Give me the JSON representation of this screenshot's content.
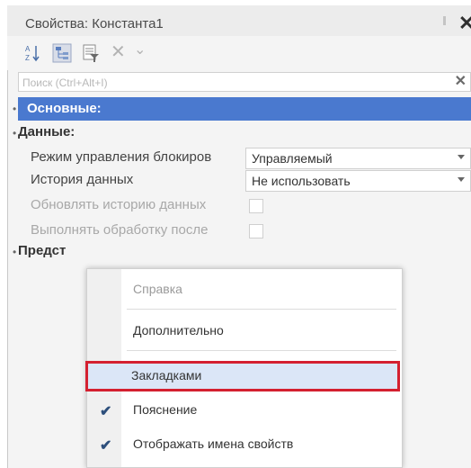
{
  "window": {
    "title": "Свойства: Константа1"
  },
  "search": {
    "placeholder": "Поиск (Ctrl+Alt+I)"
  },
  "groups": {
    "main": "Основные:",
    "data": "Данные:",
    "presentation": "Предст"
  },
  "properties": [
    {
      "label": "Режим управления блокиров",
      "value": "Управляемый"
    },
    {
      "label": "История данных",
      "value": "Не использовать"
    },
    {
      "label": "Обновлять историю данных",
      "value": ""
    },
    {
      "label": "Выполнять обработку после",
      "value": ""
    }
  ],
  "context_menu": {
    "items": [
      {
        "label": "Справка",
        "checked": false,
        "disabled": true
      },
      {
        "label": "Дополнительно",
        "checked": false,
        "disabled": false
      },
      {
        "label": "Закладками",
        "checked": false,
        "highlighted": true
      },
      {
        "label": "Пояснение",
        "checked": true
      },
      {
        "label": "Отображать имена свойств",
        "checked": true
      }
    ]
  },
  "colors": {
    "selected_group": "#4a79cf",
    "highlight_border": "#d42030",
    "highlight_fill": "#dbe6f7"
  }
}
